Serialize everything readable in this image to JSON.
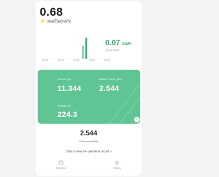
{
  "summary": {
    "total_value": "0.68",
    "total_label": "totalEle(kWh)"
  },
  "chart": {
    "ticks": [
      "01:00",
      "06:00",
      "12:00",
      "18:00",
      "23:00"
    ],
    "reading_value": "0.07",
    "reading_unit": "kWh",
    "reading_time": "10:55-23:55"
  },
  "chart_data": {
    "type": "bar",
    "title": "",
    "categories": [
      "01:00",
      "06:00",
      "12:00",
      "18:00",
      "23:00"
    ],
    "values": [
      0,
      0,
      0.07,
      0,
      0
    ],
    "xlabel": "",
    "ylabel": "",
    "ylim": [
      0,
      0.08
    ],
    "grid": false,
    "accent": "#3fae7a"
  },
  "metrics": {
    "current_label": "Current (A)",
    "current_value": "11.344",
    "active_power_label": "Active Power (kW)",
    "active_power_value": "2.544",
    "voltage_label": "Voltage (V)",
    "voltage_value": "224.3"
  },
  "total_power": {
    "value": "2.544",
    "label": "Total power(kW)"
  },
  "record_link": "Click to view the operation record >",
  "nav": {
    "left_label": "Statistics",
    "right_label": "Setting"
  },
  "colors": {
    "panel": "#5fc594",
    "accent_text": "#3fae7a",
    "bolt": "#f3c233"
  }
}
